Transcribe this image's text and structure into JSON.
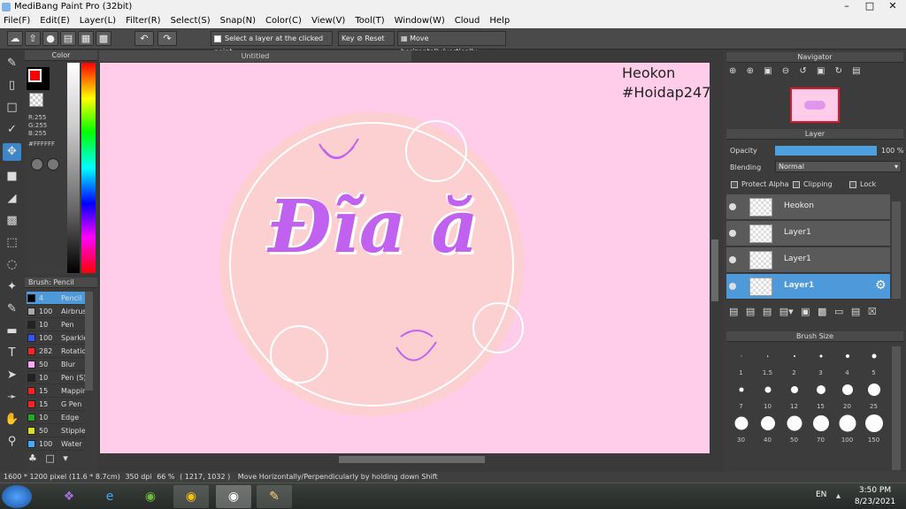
{
  "app": {
    "title": "MediBang Paint Pro (32bit)"
  },
  "menu": [
    "File(F)",
    "Edit(E)",
    "Layer(L)",
    "Filter(R)",
    "Select(S)",
    "Snap(N)",
    "Color(C)",
    "View(V)",
    "Tool(T)",
    "Window(W)",
    "Cloud",
    "Help"
  ],
  "toolbar": {
    "select_layer_label": "Select a layer at the clicked point",
    "key_label": "Key",
    "reset_label": "Reset",
    "move_label": "Move horizontally/vertically"
  },
  "color_panel": {
    "title": "Color",
    "r": "R:255",
    "g": "G:255",
    "b": "B:255",
    "hex": "#FFFFFF",
    "primary_color": "#ff0000",
    "secondary_color": "#000000"
  },
  "brush_panel": {
    "title": "Brush: Pencil",
    "items": [
      {
        "size": "4",
        "name": "Pencil",
        "color": "#000000",
        "selected": true
      },
      {
        "size": "100",
        "name": "Airbrush",
        "color": "#aaaaaa"
      },
      {
        "size": "10",
        "name": "Pen",
        "color": "#222222"
      },
      {
        "size": "100",
        "name": "Sparkle",
        "color": "#3355ff"
      },
      {
        "size": "282",
        "name": "Rotation",
        "color": "#ff2222"
      },
      {
        "size": "50",
        "name": "Blur",
        "color": "#ffaaff"
      },
      {
        "size": "10",
        "name": "Pen (S)",
        "color": "#222222"
      },
      {
        "size": "15",
        "name": "Mapping",
        "color": "#ff2222"
      },
      {
        "size": "15",
        "name": "G Pen",
        "color": "#ff2222"
      },
      {
        "size": "10",
        "name": "Edge",
        "color": "#22aa22"
      },
      {
        "size": "50",
        "name": "Stipple",
        "color": "#dddd22"
      },
      {
        "size": "100",
        "name": "Water",
        "color": "#44aaff"
      }
    ]
  },
  "canvas": {
    "tab_title": "Untitled",
    "text_line1": "Heokon",
    "text_line2": "#Hoidap247",
    "main_text": "Đĩa ă",
    "background": "#ffcde9",
    "circle_fill": "#fccfd0",
    "lettering_color": "#c062ef"
  },
  "navigator": {
    "title": "Navigator"
  },
  "layer_panel": {
    "title": "Layer",
    "opacity_label": "Opacity",
    "opacity_value": "100 %",
    "opacity_fraction": 1.0,
    "blending_label": "Blending",
    "blending_value": "Normal",
    "protect_alpha": "Protect Alpha",
    "clipping": "Clipping",
    "lock": "Lock",
    "layers": [
      {
        "name": "Heokon",
        "selected": false
      },
      {
        "name": "Layer1",
        "selected": false
      },
      {
        "name": "Layer1",
        "selected": false
      },
      {
        "name": "Layer1",
        "selected": true
      }
    ]
  },
  "brush_size_panel": {
    "title": "Brush Size",
    "sizes": [
      "1",
      "1.5",
      "2",
      "3",
      "4",
      "5",
      "7",
      "10",
      "12",
      "15",
      "20",
      "25",
      "30",
      "40",
      "50",
      "70",
      "100",
      "150"
    ]
  },
  "status": {
    "pixels": "1600 * 1200 pixel",
    "cm": "(11.6 * 8.7cm)",
    "dpi": "350 dpi",
    "zoom": "66 %",
    "coords": "( 1217, 1032 )",
    "hint": "Move Horizontally/Perpendicularly by holding down Shift"
  },
  "taskbar": {
    "lang": "EN",
    "time": "3:50 PM",
    "date": "8/23/2021"
  }
}
